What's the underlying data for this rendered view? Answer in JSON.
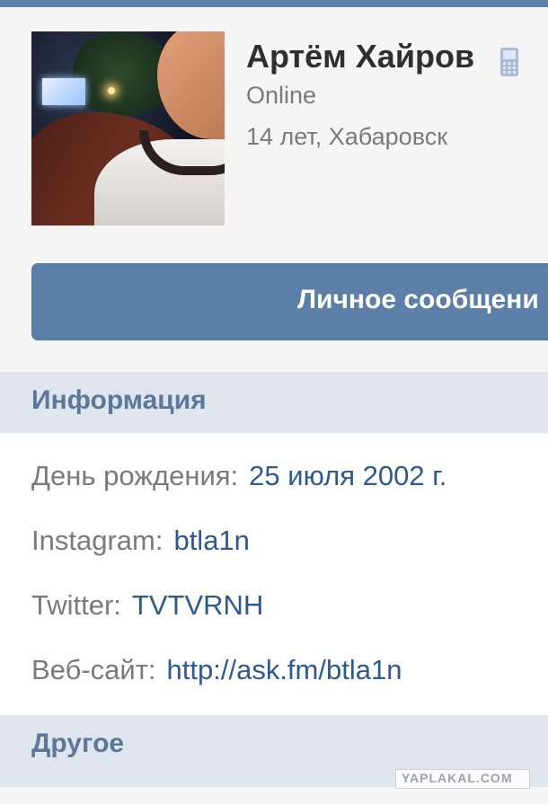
{
  "profile": {
    "name": "Артём Хайров",
    "status": "Online",
    "age_location": "14 лет, Хабаровск",
    "message_button_label": "Личное сообщени"
  },
  "info_section": {
    "title": "Информация",
    "rows": [
      {
        "label": "День рождения:",
        "value": "25 июля 2002 г."
      },
      {
        "label": "Instagram:",
        "value": "btla1n"
      },
      {
        "label": "Twitter:",
        "value": "TVTVRNH"
      },
      {
        "label": "Веб-сайт:",
        "value": "http://ask.fm/btla1n"
      }
    ]
  },
  "other_section": {
    "title": "Другое"
  },
  "watermark": "YAPLAKAL.COM",
  "colors": {
    "accent": "#5b7fa6",
    "header_bg": "#dfe5ec",
    "link": "#2e5a8e"
  },
  "icons": {
    "status_device": "mobile-phone-icon"
  }
}
